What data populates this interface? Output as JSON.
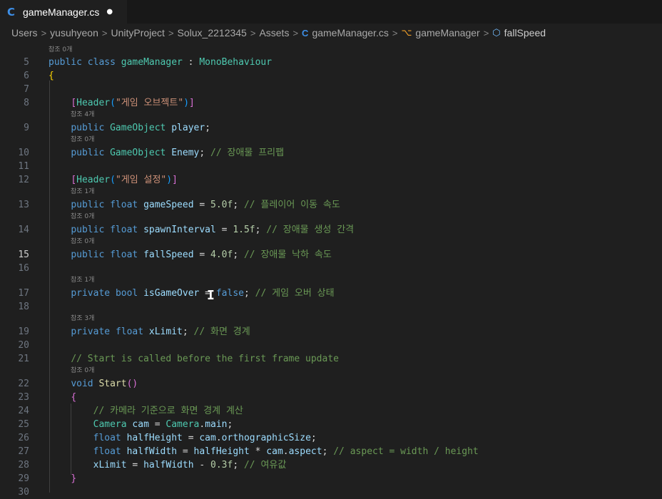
{
  "tab": {
    "icon": "csharp-file-icon",
    "title": "gameManager.cs",
    "modified_dot": "●"
  },
  "breadcrumb": {
    "items": [
      "Users",
      "yusuhyeon",
      "UnityProject",
      "Solux_2212345",
      "Assets",
      "gameManager.cs",
      "gameManager",
      "fallSpeed"
    ],
    "separator": ">",
    "icons": {
      "file": "csharp-file-icon",
      "class": "class-icon",
      "field": "field-icon"
    }
  },
  "codelens": {
    "ref0": "참조 0개",
    "ref1": "참조 1개",
    "ref3": "참조 3개",
    "ref4": "참조 4개"
  },
  "lines": [
    {
      "n": "5",
      "tokens": [
        [
          "kw",
          "public"
        ],
        [
          "pl",
          " "
        ],
        [
          "kw",
          "class"
        ],
        [
          "pl",
          " "
        ],
        [
          "ty",
          "gameManager"
        ],
        [
          "pl",
          " : "
        ],
        [
          "ty",
          "MonoBehaviour"
        ]
      ]
    },
    {
      "n": "6",
      "tokens": [
        [
          "br1",
          "{"
        ]
      ]
    },
    {
      "n": "7",
      "tokens": []
    },
    {
      "n": "8",
      "tokens": [
        [
          "pl",
          "    "
        ],
        [
          "br2",
          "["
        ],
        [
          "ty",
          "Header"
        ],
        [
          "br3",
          "("
        ],
        [
          "st",
          "\"게임 오브젝트\""
        ],
        [
          "br3",
          ")"
        ],
        [
          "br2",
          "]"
        ]
      ]
    },
    {
      "n": "9",
      "tokens": [
        [
          "pl",
          "    "
        ],
        [
          "kw",
          "public"
        ],
        [
          "pl",
          " "
        ],
        [
          "ty",
          "GameObject"
        ],
        [
          "pl",
          " "
        ],
        [
          "id",
          "player"
        ],
        [
          "pl",
          ";"
        ]
      ]
    },
    {
      "n": "10",
      "tokens": [
        [
          "pl",
          "    "
        ],
        [
          "kw",
          "public"
        ],
        [
          "pl",
          " "
        ],
        [
          "ty",
          "GameObject"
        ],
        [
          "pl",
          " "
        ],
        [
          "id",
          "Enemy"
        ],
        [
          "pl",
          "; "
        ],
        [
          "cm",
          "// 장애물 프리팹"
        ]
      ]
    },
    {
      "n": "11",
      "tokens": []
    },
    {
      "n": "12",
      "tokens": [
        [
          "pl",
          "    "
        ],
        [
          "br2",
          "["
        ],
        [
          "ty",
          "Header"
        ],
        [
          "br3",
          "("
        ],
        [
          "st",
          "\"게임 설정\""
        ],
        [
          "br3",
          ")"
        ],
        [
          "br2",
          "]"
        ]
      ]
    },
    {
      "n": "13",
      "tokens": [
        [
          "pl",
          "    "
        ],
        [
          "kw",
          "public"
        ],
        [
          "pl",
          " "
        ],
        [
          "kw",
          "float"
        ],
        [
          "pl",
          " "
        ],
        [
          "id",
          "gameSpeed"
        ],
        [
          "pl",
          " = "
        ],
        [
          "nm",
          "5.0f"
        ],
        [
          "pl",
          "; "
        ],
        [
          "cm",
          "// 플레이어 이동 속도"
        ]
      ]
    },
    {
      "n": "14",
      "tokens": [
        [
          "pl",
          "    "
        ],
        [
          "kw",
          "public"
        ],
        [
          "pl",
          " "
        ],
        [
          "kw",
          "float"
        ],
        [
          "pl",
          " "
        ],
        [
          "id",
          "spawnInterval"
        ],
        [
          "pl",
          " = "
        ],
        [
          "nm",
          "1.5f"
        ],
        [
          "pl",
          "; "
        ],
        [
          "cm",
          "// 장애물 생성 간격"
        ]
      ]
    },
    {
      "n": "15",
      "tokens": [
        [
          "pl",
          "    "
        ],
        [
          "kw",
          "public"
        ],
        [
          "pl",
          " "
        ],
        [
          "kw",
          "float"
        ],
        [
          "pl",
          " "
        ],
        [
          "id",
          "fallSpeed"
        ],
        [
          "pl",
          " = "
        ],
        [
          "nm",
          "4.0f"
        ],
        [
          "pl",
          "; "
        ],
        [
          "cm",
          "// 장애물 낙하 속도"
        ]
      ]
    },
    {
      "n": "16",
      "tokens": []
    },
    {
      "n": "17",
      "tokens": [
        [
          "pl",
          "    "
        ],
        [
          "kw",
          "private"
        ],
        [
          "pl",
          " "
        ],
        [
          "kw",
          "bool"
        ],
        [
          "pl",
          " "
        ],
        [
          "id",
          "isGameOver"
        ],
        [
          "pl",
          " = "
        ],
        [
          "kw",
          "false"
        ],
        [
          "pl",
          "; "
        ],
        [
          "cm",
          "// 게임 오버 상태"
        ]
      ]
    },
    {
      "n": "18",
      "tokens": []
    },
    {
      "n": "19",
      "tokens": [
        [
          "pl",
          "    "
        ],
        [
          "kw",
          "private"
        ],
        [
          "pl",
          " "
        ],
        [
          "kw",
          "float"
        ],
        [
          "pl",
          " "
        ],
        [
          "id",
          "xLimit"
        ],
        [
          "pl",
          "; "
        ],
        [
          "cm",
          "// 화면 경계"
        ]
      ]
    },
    {
      "n": "20",
      "tokens": []
    },
    {
      "n": "21",
      "tokens": [
        [
          "pl",
          "    "
        ],
        [
          "cm",
          "// Start is called before the first frame update"
        ]
      ]
    },
    {
      "n": "22",
      "tokens": [
        [
          "pl",
          "    "
        ],
        [
          "kw",
          "void"
        ],
        [
          "pl",
          " "
        ],
        [
          "fn",
          "Start"
        ],
        [
          "br2",
          "()"
        ]
      ]
    },
    {
      "n": "23",
      "tokens": [
        [
          "pl",
          "    "
        ],
        [
          "br2",
          "{"
        ]
      ]
    },
    {
      "n": "24",
      "tokens": [
        [
          "pl",
          "        "
        ],
        [
          "cm",
          "// 카메라 기준으로 화면 경계 계산"
        ]
      ]
    },
    {
      "n": "25",
      "tokens": [
        [
          "pl",
          "        "
        ],
        [
          "ty",
          "Camera"
        ],
        [
          "pl",
          " "
        ],
        [
          "id",
          "cam"
        ],
        [
          "pl",
          " = "
        ],
        [
          "ty",
          "Camera"
        ],
        [
          "pl",
          "."
        ],
        [
          "id",
          "main"
        ],
        [
          "pl",
          ";"
        ]
      ]
    },
    {
      "n": "26",
      "tokens": [
        [
          "pl",
          "        "
        ],
        [
          "kw",
          "float"
        ],
        [
          "pl",
          " "
        ],
        [
          "id",
          "halfHeight"
        ],
        [
          "pl",
          " = "
        ],
        [
          "id",
          "cam"
        ],
        [
          "pl",
          "."
        ],
        [
          "id",
          "orthographicSize"
        ],
        [
          "pl",
          ";"
        ]
      ]
    },
    {
      "n": "27",
      "tokens": [
        [
          "pl",
          "        "
        ],
        [
          "kw",
          "float"
        ],
        [
          "pl",
          " "
        ],
        [
          "id",
          "halfWidth"
        ],
        [
          "pl",
          " = "
        ],
        [
          "id",
          "halfHeight"
        ],
        [
          "pl",
          " * "
        ],
        [
          "id",
          "cam"
        ],
        [
          "pl",
          "."
        ],
        [
          "id",
          "aspect"
        ],
        [
          "pl",
          "; "
        ],
        [
          "cm",
          "// aspect = width / height"
        ]
      ]
    },
    {
      "n": "28",
      "tokens": [
        [
          "pl",
          "        "
        ],
        [
          "id",
          "xLimit"
        ],
        [
          "pl",
          " = "
        ],
        [
          "id",
          "halfWidth"
        ],
        [
          "pl",
          " - "
        ],
        [
          "nm",
          "0.3f"
        ],
        [
          "pl",
          "; "
        ],
        [
          "cm",
          "// 여유값"
        ]
      ]
    },
    {
      "n": "29",
      "tokens": [
        [
          "pl",
          "    "
        ],
        [
          "br2",
          "}"
        ]
      ]
    },
    {
      "n": "30",
      "tokens": []
    }
  ],
  "current_line": "15",
  "colors": {
    "background": "#1f1f1f",
    "keyword": "#569cd6",
    "type": "#4ec9b0",
    "identifier": "#9cdcfe",
    "string": "#ce9178",
    "comment": "#6a9955",
    "number": "#b5cea8"
  }
}
